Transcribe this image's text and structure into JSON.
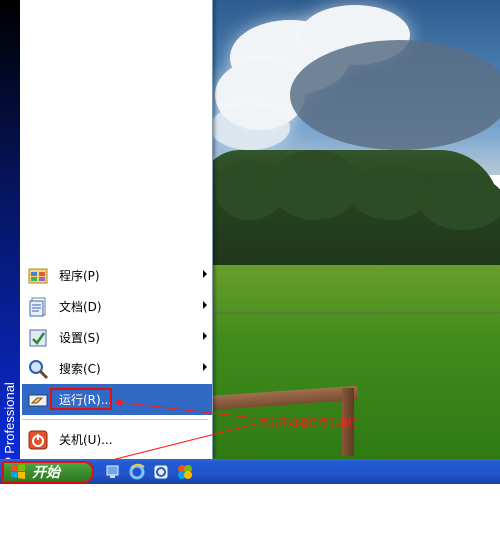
{
  "start_menu": {
    "side_banner": {
      "brand": "Windows XP",
      "edition": "Professional"
    },
    "items": [
      {
        "label": "程序(P)",
        "icon": "programs-icon",
        "has_submenu": true
      },
      {
        "label": "文档(D)",
        "icon": "documents-icon",
        "has_submenu": true
      },
      {
        "label": "设置(S)",
        "icon": "settings-icon",
        "has_submenu": true
      },
      {
        "label": "搜索(C)",
        "icon": "search-icon",
        "has_submenu": true
      },
      {
        "label": "运行(R)...",
        "icon": "run-icon",
        "has_submenu": false,
        "selected": true
      },
      {
        "label": "关机(U)...",
        "icon": "shutdown-icon",
        "has_submenu": false
      }
    ]
  },
  "annotation": {
    "text": "点击开始运行点击运行",
    "color": "#ff1a1a"
  },
  "taskbar": {
    "start_label": "开始",
    "quick_launch": [
      "show-desktop-icon",
      "internet-explorer-icon",
      "outlook-express-icon",
      "media-player-icon"
    ]
  },
  "colors": {
    "selection": "#316ac5",
    "taskbar": "#2255cc",
    "start_button": "#3a8f2c",
    "highlight": "#e01010"
  }
}
